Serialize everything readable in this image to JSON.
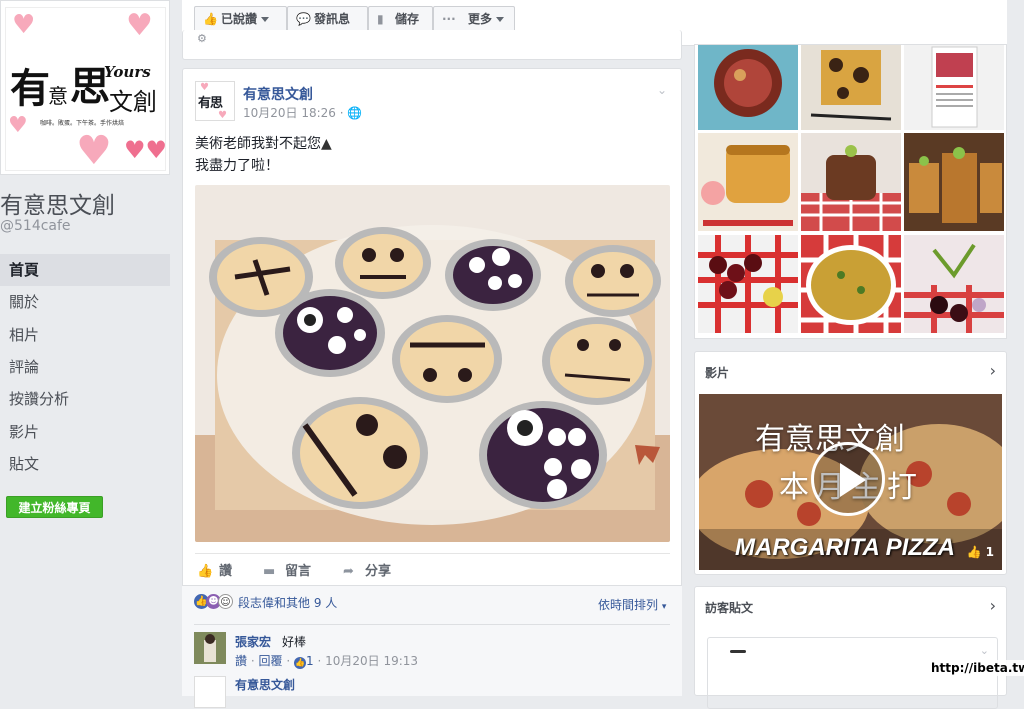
{
  "page": {
    "name": "有意思文創",
    "handle": "@514cafe",
    "logo": {
      "main_chars": [
        "有",
        "意",
        "思",
        "文",
        "創"
      ],
      "yours_text": "Yours",
      "tagline": "咖啡。敗蛋。下午茶。手作烘焙"
    }
  },
  "nav": {
    "items": [
      {
        "label": "首頁",
        "active": true
      },
      {
        "label": "關於"
      },
      {
        "label": "相片"
      },
      {
        "label": "評論"
      },
      {
        "label": "按讚分析"
      },
      {
        "label": "影片"
      },
      {
        "label": "貼文"
      }
    ],
    "create_button": "建立粉絲專頁"
  },
  "top_bar": {
    "liked_label": "已說讚",
    "message_label": "發訊息",
    "save_label": "儲存",
    "more_label": "更多"
  },
  "post": {
    "author": "有意思文創",
    "timestamp": "10月20日 18:26 ·",
    "audience_icon": "globe-icon",
    "text_line1": "美術老師我對不起您",
    "text_line2": "我盡力了啦！",
    "actions": {
      "like": "讚",
      "comment": "留言",
      "share": "分享"
    }
  },
  "reactions": {
    "summary": "段志偉和其他 9 人",
    "sort_label": "依時間排列"
  },
  "comments": [
    {
      "author": "張家宏",
      "text": "好棒",
      "like_label": "讚",
      "reply_label": "回覆",
      "like_count": "1",
      "timestamp": "10月20日 19:13"
    },
    {
      "author": "有意思文創"
    }
  ],
  "sidebar": {
    "videos_title": "影片",
    "video": {
      "title_line1": "有意思文創",
      "title_line2": "本月主打",
      "caption": "MARGARITA PIZZA",
      "like_count": "1"
    },
    "visitor_posts_title": "訪客貼文"
  },
  "watermark": "http://ibeta.tw",
  "colors": {
    "fb_blue": "#365899",
    "green": "#42b72a",
    "page_bg": "#e9ebee"
  }
}
